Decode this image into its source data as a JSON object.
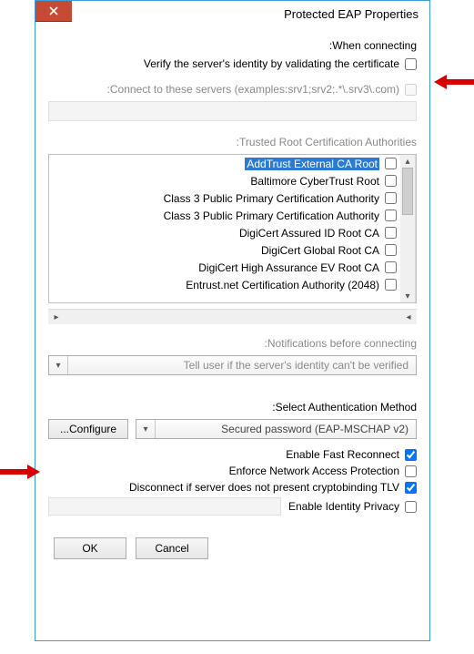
{
  "window": {
    "title": "Protected EAP Properties"
  },
  "sections": {
    "when_connecting": "When connecting:",
    "verify_identity": "Verify the server's identity by validating the certificate",
    "connect_servers": "Connect to these servers (examples:srv1;srv2;.*\\.srv3\\.com):",
    "trusted_root": "Trusted Root Certification Authorities:",
    "notifications": "Notifications before connecting:",
    "notify_option": "Tell user if the server's identity can't be verified",
    "auth_method": "Select Authentication Method:",
    "auth_option": "Secured password (EAP-MSCHAP v2)",
    "configure": "Configure...",
    "fast_reconnect": "Enable Fast Reconnect",
    "nap": "Enforce Network Access Protection",
    "cryptobinding": "Disconnect if server does not present cryptobinding TLV",
    "identity_privacy": "Enable Identity Privacy",
    "ok": "OK",
    "cancel": "Cancel"
  },
  "ca_list": [
    "AddTrust External CA Root",
    "Baltimore CyberTrust Root",
    "Class 3 Public Primary Certification Authority",
    "Class 3 Public Primary Certification Authority",
    "DigiCert Assured ID Root CA",
    "DigiCert Global Root CA",
    "DigiCert High Assurance EV Root CA",
    "Entrust.net Certification Authority (2048)"
  ],
  "checks": {
    "verify_identity": false,
    "fast_reconnect": true,
    "nap": false,
    "cryptobinding": true,
    "identity_privacy": false
  }
}
